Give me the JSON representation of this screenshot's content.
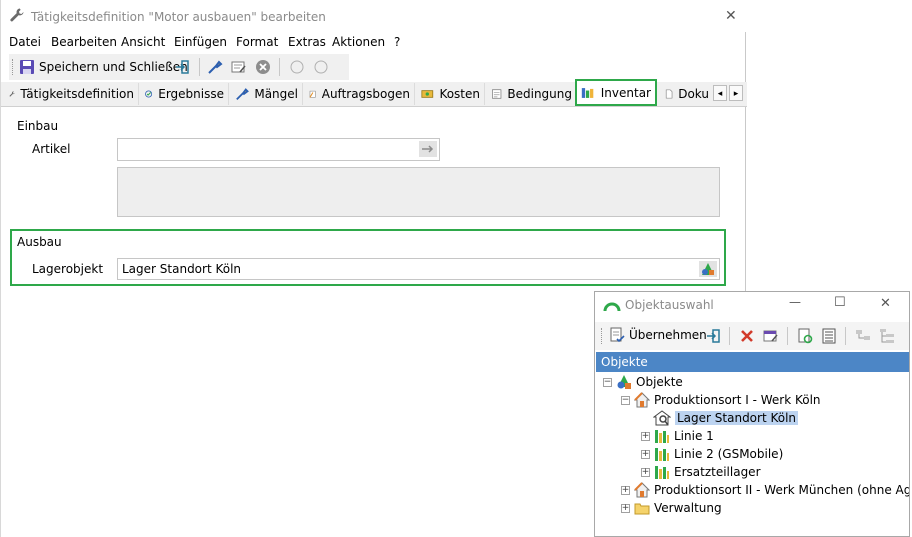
{
  "window": {
    "title": "Tätigkeitsdefinition \"Motor ausbauen\" bearbeiten",
    "close_glyph": "✕"
  },
  "menu": [
    "Datei",
    "Bearbeiten",
    "Ansicht",
    "Einfügen",
    "Format",
    "Extras",
    "Aktionen",
    "?"
  ],
  "toolbar": {
    "save_close_label": "Speichern und Schließen"
  },
  "tabs": [
    {
      "label": "Tätigkeitsdefinition"
    },
    {
      "label": "Ergebnisse"
    },
    {
      "label": "Mängel"
    },
    {
      "label": "Auftragsbogen"
    },
    {
      "label": "Kosten"
    },
    {
      "label": "Bedingung"
    },
    {
      "label": "Inventar"
    },
    {
      "label": "Doku"
    }
  ],
  "tab_scroll": {
    "left": "◂",
    "right": "▸"
  },
  "einbau": {
    "heading": "Einbau",
    "artikel_label": "Artikel",
    "artikel_value": ""
  },
  "ausbau": {
    "heading": "Ausbau",
    "lagerobjekt_label": "Lagerobjekt",
    "lagerobjekt_value": "Lager Standort Köln"
  },
  "popup": {
    "title": "Objektauswahl",
    "minimize_glyph": "—",
    "maximize_glyph": "☐",
    "close_glyph": "✕",
    "uebernehmen_label": "Übernehmen",
    "header": "Objekte",
    "tree": [
      {
        "label": "Objekte",
        "expander": "−"
      },
      {
        "label": "Produktionsort I - Werk Köln",
        "expander": "−"
      },
      {
        "label": "Lager Standort Köln",
        "expander": "",
        "selected": true
      },
      {
        "label": "Linie 1",
        "expander": "+"
      },
      {
        "label": "Linie 2 (GSMobile)",
        "expander": "+"
      },
      {
        "label": "Ersatzteillager",
        "expander": "+"
      },
      {
        "label": "Produktionsort II - Werk München (ohne Aggre",
        "expander": "+"
      },
      {
        "label": "Verwaltung",
        "expander": "+"
      }
    ]
  },
  "colors": {
    "highlight_green": "#2ea84a",
    "header_blue": "#4c86c6",
    "selection_blue": "#bcd3f0"
  }
}
